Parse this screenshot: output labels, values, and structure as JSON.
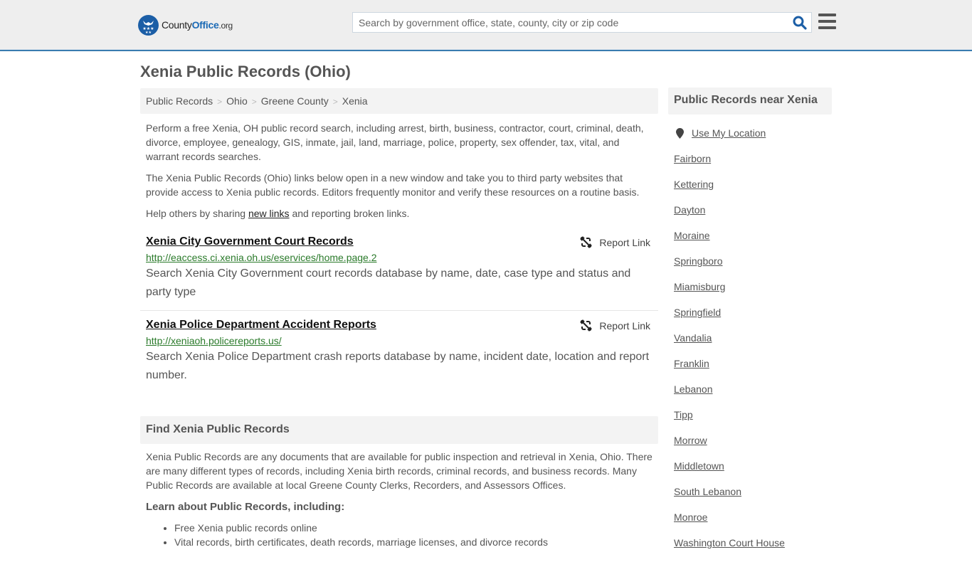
{
  "header": {
    "logo": {
      "part1": "County",
      "part2": "Office",
      "part3": ".org"
    },
    "search": {
      "placeholder": "Search by government office, state, county, city or zip code",
      "value": ""
    },
    "icons": {
      "search": "search-icon",
      "menu": "hamburger-menu-icon"
    }
  },
  "page": {
    "title": "Xenia Public Records (Ohio)"
  },
  "breadcrumb": [
    {
      "label": "Public Records"
    },
    {
      "label": "Ohio"
    },
    {
      "label": "Greene County"
    },
    {
      "label": "Xenia"
    }
  ],
  "breadcrumb_separator": ">",
  "intro": {
    "p1": "Perform a free Xenia, OH public record search, including arrest, birth, business, contractor, court, criminal, death, divorce, employee, genealogy, GIS, inmate, jail, land, marriage, police, property, sex offender, tax, vital, and warrant records searches.",
    "p2": "The Xenia Public Records (Ohio) links below open in a new window and take you to third party websites that provide access to Xenia public records. Editors frequently monitor and verify these resources on a routine basis.",
    "p3_before": "Help others by sharing ",
    "p3_link": "new links",
    "p3_after": " and reporting broken links."
  },
  "records": [
    {
      "title": "Xenia City Government Court Records",
      "url": "http://eaccess.ci.xenia.oh.us/eservices/home.page.2",
      "description": "Search Xenia City Government court records database by name, date, case type and status and party type",
      "report_label": "Report Link"
    },
    {
      "title": "Xenia Police Department Accident Reports",
      "url": "http://xeniaoh.policereports.us/",
      "description": "Search Xenia Police Department crash reports database by name, incident date, location and report number.",
      "report_label": "Report Link"
    }
  ],
  "find": {
    "heading": "Find Xenia Public Records",
    "body": "Xenia Public Records are any documents that are available for public inspection and retrieval in Xenia, Ohio. There are many different types of records, including Xenia birth records, criminal records, and business records. Many Public Records are available at local Greene County Clerks, Recorders, and Assessors Offices.",
    "learn_heading": "Learn about Public Records, including:",
    "bullets": [
      "Free Xenia public records online",
      "Vital records, birth certificates, death records, marriage licenses, and divorce records"
    ]
  },
  "sidebar": {
    "heading": "Public Records near Xenia",
    "use_location": "Use My Location",
    "cities": [
      "Fairborn",
      "Kettering",
      "Dayton",
      "Moraine",
      "Springboro",
      "Miamisburg",
      "Springfield",
      "Vandalia",
      "Franklin",
      "Lebanon",
      "Tipp",
      "Morrow",
      "Middletown",
      "South Lebanon",
      "Monroe",
      "Washington Court House"
    ]
  },
  "colors": {
    "brand_blue": "#1b5ea6",
    "header_border": "#3a7cb0",
    "url_green": "#2a7a2a",
    "panel_bg": "#f3f3f3"
  }
}
